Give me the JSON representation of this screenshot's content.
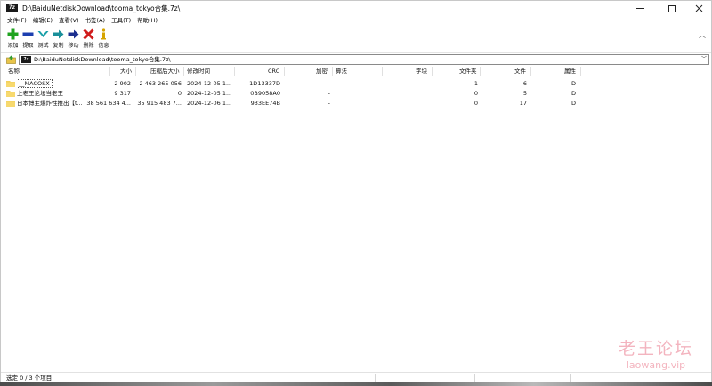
{
  "window": {
    "title": "D:\\BaiduNetdiskDownload\\tooma_tokyo合集.7z\\",
    "app_icon_text": "7z"
  },
  "menu": [
    "文件(F)",
    "编辑(E)",
    "查看(V)",
    "书签(A)",
    "工具(T)",
    "帮助(H)"
  ],
  "toolbar": [
    {
      "label": "添加",
      "icon": "plus-icon",
      "color": "#1fa31f"
    },
    {
      "label": "提取",
      "icon": "minus-icon",
      "color": "#1c3fb0"
    },
    {
      "label": "测试",
      "icon": "check-chevron-icon",
      "color": "#1aa0a8"
    },
    {
      "label": "复制",
      "icon": "arrow-right-icon",
      "color": "#1a8f9a"
    },
    {
      "label": "移动",
      "icon": "arrow-right-icon",
      "color": "#1c2f8f"
    },
    {
      "label": "删除",
      "icon": "x-icon",
      "color": "#d01c1c"
    },
    {
      "label": "信息",
      "icon": "info-icon",
      "color": "#d6a400"
    }
  ],
  "address": {
    "path": "D:\\BaiduNetdiskDownload\\tooma_tokyo合集.7z\\",
    "icon_text": "7z"
  },
  "columns": [
    "名称",
    "大小",
    "压缩后大小",
    "修改时间",
    "CRC",
    "加密",
    "算法",
    "字块",
    "文件夹",
    "文件",
    "属性"
  ],
  "rows": [
    {
      "name": "__MACOSX",
      "size": "2 902",
      "packed": "2 463 265 056",
      "modified": "2024-12-05 1...",
      "crc": "1D13337D",
      "encrypted": "-",
      "method": "",
      "block": "",
      "folders": "1",
      "files": "6",
      "attr": "D"
    },
    {
      "name": "上老王论坛当老王",
      "size": "9 317",
      "packed": "0",
      "modified": "2024-12-05 1...",
      "crc": "0B9058A0",
      "encrypted": "-",
      "method": "",
      "block": "",
      "folders": "0",
      "files": "5",
      "attr": "D"
    },
    {
      "name": "日本博主爆炸性推出【t...",
      "size": "38 561 634 4...",
      "packed": "35 915 483 7...",
      "modified": "2024-12-06 1...",
      "crc": "933EE74B",
      "encrypted": "-",
      "method": "",
      "block": "",
      "folders": "0",
      "files": "17",
      "attr": "D"
    }
  ],
  "status": {
    "selection": "选定 0 / 3 个项目"
  },
  "watermark": {
    "chinese": "老王论坛",
    "url": "laowang.vip"
  }
}
